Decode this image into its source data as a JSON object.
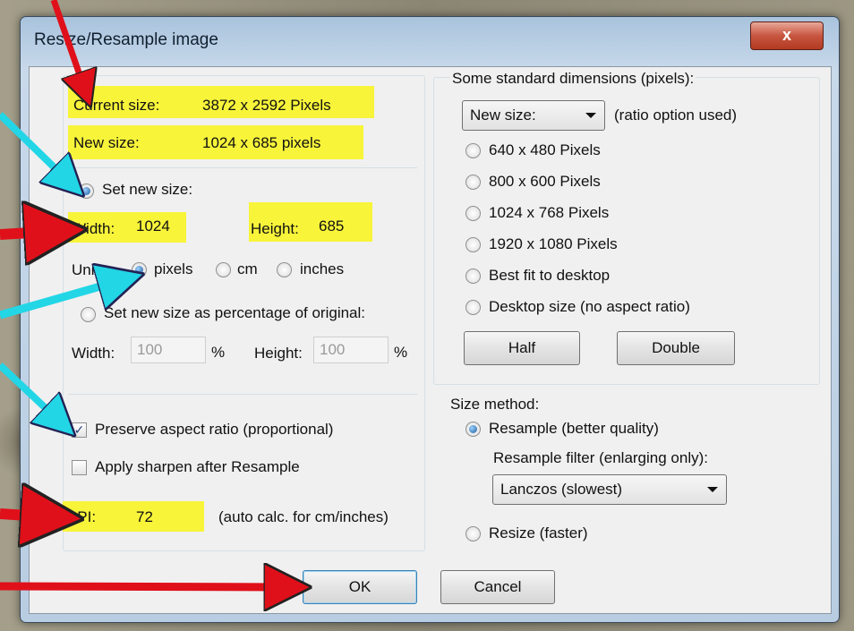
{
  "window": {
    "title": "Resize/Resample image",
    "close_glyph": "x"
  },
  "left": {
    "current_size_label": "Current size:",
    "current_size_value": "3872  x  2592  Pixels",
    "new_size_label": "New size:",
    "new_size_value": "1024  x  685  pixels",
    "set_new_size_label": "Set new size:",
    "width_label": "Width:",
    "width_value": "1024",
    "height_label": "Height:",
    "height_value": "685",
    "units_label": "Units:",
    "units": [
      "pixels",
      "cm",
      "inches"
    ],
    "selected_unit": "pixels",
    "percent_label": "Set new size as percentage of original:",
    "pct_width_label": "Width:",
    "pct_width_value": "100",
    "pct_height_label": "Height:",
    "pct_height_value": "100",
    "percent_sign": "%",
    "preserve_label": "Preserve aspect ratio (proportional)",
    "preserve_checked": true,
    "sharpen_label": "Apply sharpen after Resample",
    "sharpen_checked": false,
    "dpi_label": "DPI:",
    "dpi_value": "72",
    "dpi_hint": "(auto calc. for cm/inches)"
  },
  "right": {
    "std_title": "Some standard dimensions (pixels):",
    "new_size_select": "New size:",
    "ratio_label": "(ratio option used)",
    "options": [
      "640 x 480 Pixels",
      "800 x 600 Pixels",
      "1024 x 768 Pixels",
      "1920 x 1080 Pixels",
      "Best fit to desktop",
      "Desktop size (no aspect ratio)"
    ],
    "half_label": "Half",
    "double_label": "Double",
    "size_method_title": "Size method:",
    "resample_label": "Resample (better quality)",
    "filter_label": "Resample filter (enlarging only):",
    "filter_value": "Lanczos (slowest)",
    "resize_label": "Resize (faster)"
  },
  "footer": {
    "ok_label": "OK",
    "cancel_label": "Cancel"
  },
  "colors": {
    "highlight": "#f8f43a",
    "arrow_red": "#e0101a",
    "arrow_cyan": "#22d6e6"
  },
  "icons": [
    "close-icon",
    "dropdown-arrow-icon",
    "checkmark-icon"
  ]
}
